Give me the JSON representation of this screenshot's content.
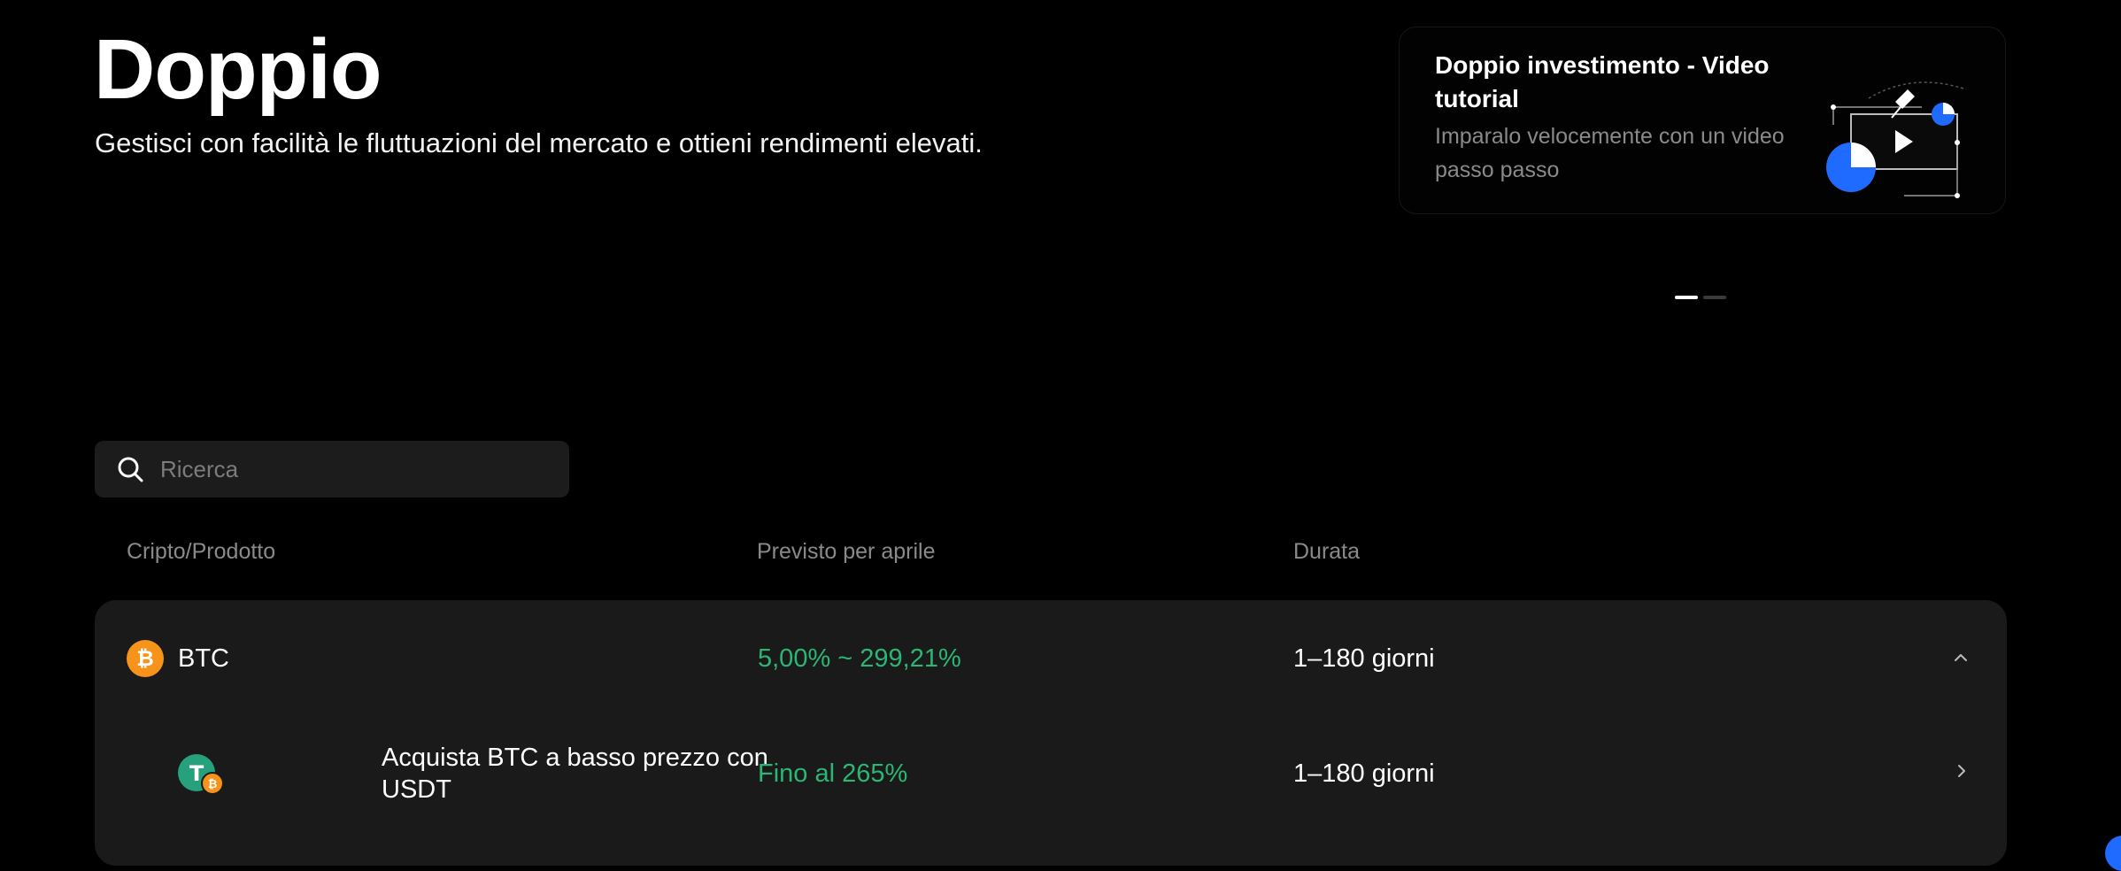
{
  "header": {
    "title": "Doppio",
    "subtitle": "Gestisci con facilità le fluttuazioni del mercato e ottieni rendimenti elevati."
  },
  "promo": {
    "title": "Doppio investimento - Video tutorial",
    "description": "Imparalo velocemente con un video passo passo",
    "illustration_icon": "video-play-illustration"
  },
  "carousel": {
    "dots": 2,
    "active_index": 0
  },
  "search": {
    "placeholder": "Ricerca",
    "value": "",
    "icon": "search-icon"
  },
  "table": {
    "columns": [
      "Cripto/Prodotto",
      "Previsto per aprile",
      "Durata"
    ],
    "rows": [
      {
        "asset": "BTC",
        "icon": "bitcoin-icon",
        "apr": "5,00% ~ 299,21%",
        "duration": "1–180 giorni",
        "expanded": true,
        "products": [
          {
            "name": "Acquista BTC a basso prezzo con USDT",
            "icon": "usdt-btc-pair-icon",
            "apr": "Fino al 265%",
            "duration": "1–180 giorni"
          }
        ]
      }
    ]
  },
  "colors": {
    "background": "#000000",
    "card": "#1a1a1a",
    "positive": "#2bb673",
    "bitcoin": "#f7931a",
    "tether": "#26a17b",
    "accent_blue": "#1f6bff"
  }
}
